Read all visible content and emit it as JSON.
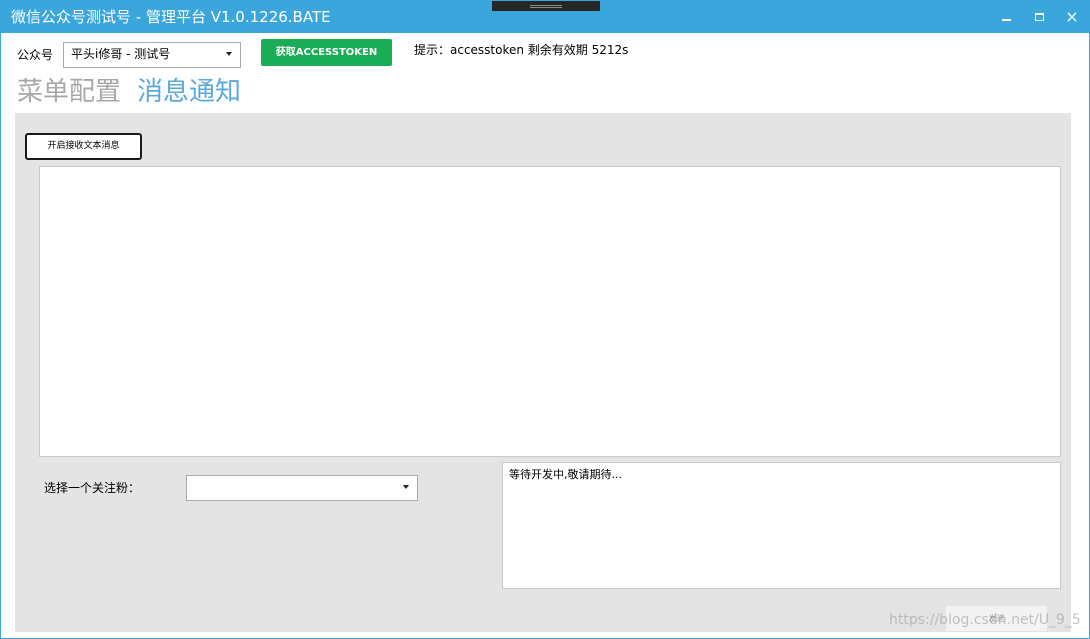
{
  "window": {
    "title": "微信公众号测试号 - 管理平台 V1.0.1226.BATE",
    "controls": {
      "minimize": "",
      "maximize": "",
      "close": "×"
    }
  },
  "header": {
    "account_label": "公众号",
    "account_select_value": "平头i修哥 - 测试号",
    "token_button_label": "获取ACCESSTOKEN",
    "hint_text": "提示：accesstoken 剩余有效期 5212s"
  },
  "tabs": [
    {
      "label": "菜单配置",
      "active": false
    },
    {
      "label": "消息通知",
      "active": true
    }
  ],
  "message_panel": {
    "enable_button_label": "开启接收文本消息",
    "log_text": "",
    "fan_label": "选择一个关注粉：",
    "fan_select_value": "",
    "dev_text": "等待开发中,敬请期待...",
    "send_button_label": "发送"
  },
  "watermark": "https://blog.csdn.net/U_9_5",
  "colors": {
    "titlebar": "#3aa6dc",
    "token_button": "#1aad57",
    "active_tab": "#5aa8dc",
    "inactive_tab": "#a8a8a8",
    "panel": "#e4e4e4"
  },
  "icons": {
    "minimize": "minimize-icon",
    "maximize": "maximize-icon",
    "close": "close-icon",
    "dropdown": "chevron-down-icon"
  }
}
